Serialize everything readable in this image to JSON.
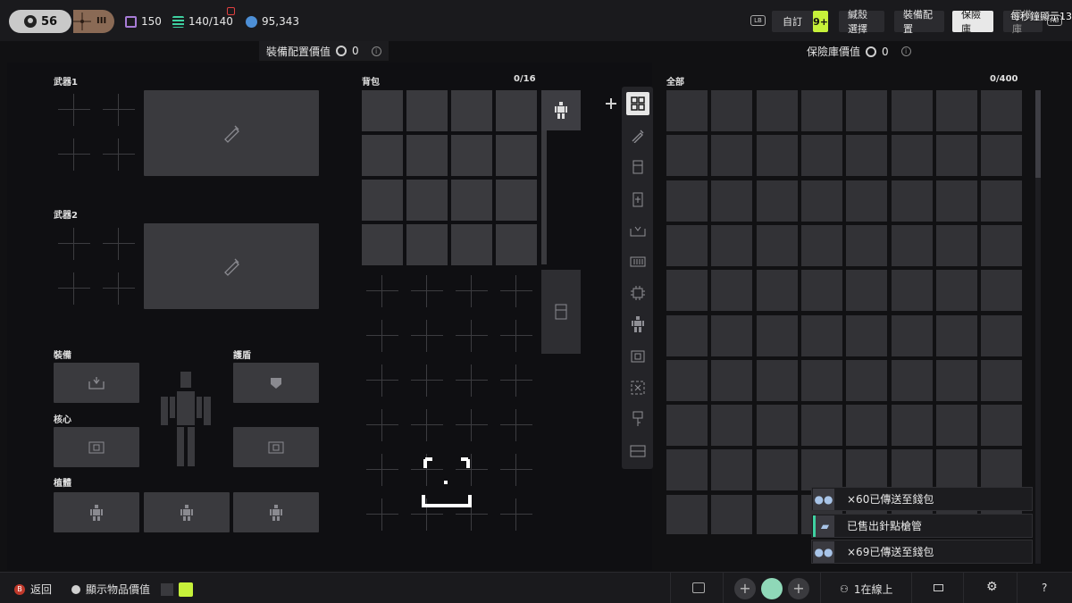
{
  "topbar": {
    "level": "56",
    "rank": "III",
    "stat1": "150",
    "stat2": "140/140",
    "credits": "95,343",
    "buttons": {
      "custom": "自訂",
      "badge": "9+",
      "shell_select": "緘殼選擇",
      "loadout": "裝備配置",
      "vault": "保險庫",
      "extra": "軍備庫"
    },
    "lb_key": "LB",
    "rb_key": "RB",
    "overlay_text": "每秒鐘顯示13"
  },
  "loadout_panel": {
    "header": "裝備配置價值",
    "value": "0",
    "weapon1": "武器1",
    "weapon2": "武器2",
    "equipment": "裝備",
    "shield": "護盾",
    "core": "核心",
    "implant": "植體"
  },
  "backpack": {
    "title": "背包",
    "count": "0/16"
  },
  "vault_panel": {
    "header": "保險庫價值",
    "value": "0",
    "filter": "全部",
    "count": "0/400"
  },
  "toolbar": {
    "icons": [
      "grid-icon",
      "weapon-icon",
      "mag-icon",
      "battery-icon",
      "inbox-icon",
      "ammo-icon",
      "chip-icon",
      "body-icon",
      "core-icon",
      "x-box-icon",
      "key-icon",
      "card-icon"
    ]
  },
  "notifications": [
    {
      "text": "×60已傳送至錢包"
    },
    {
      "text": "已售出針點槍管"
    },
    {
      "text": "×69已傳送至錢包"
    }
  ],
  "bottombar": {
    "back_key": "B",
    "back": "返回",
    "show_value": "顯示物品價值",
    "online": "1在線上",
    "help": "?"
  },
  "colors": {
    "accent_green": "#c6f13a",
    "rank_bronze": "#8a6a55",
    "purple": "#a77bd6",
    "teal": "#3fd1a1",
    "blue": "#4d8fd6"
  }
}
